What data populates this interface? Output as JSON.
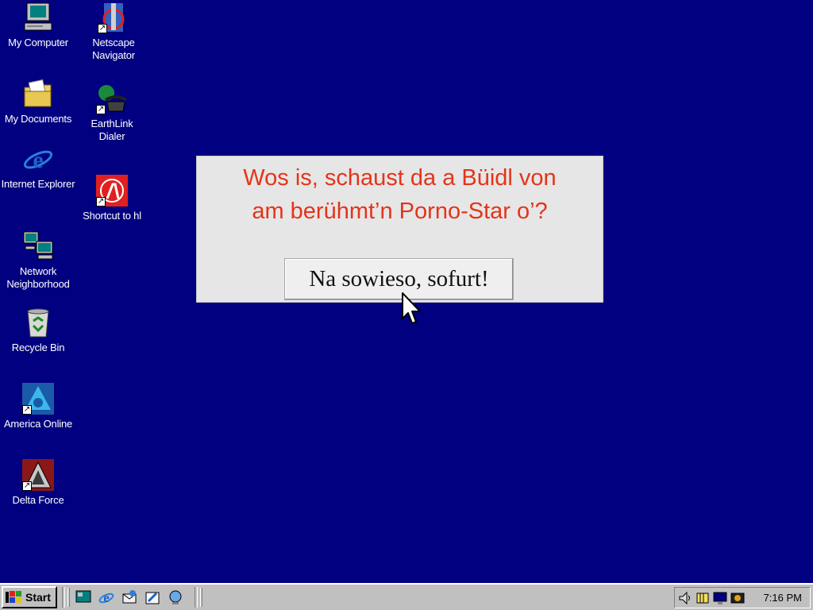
{
  "desktop": {
    "background": "#000080",
    "icons": [
      {
        "label": "My Computer",
        "icon": "computer-icon"
      },
      {
        "label": "My Documents",
        "icon": "folder-documents-icon"
      },
      {
        "label": "Internet Explorer",
        "icon": "internet-explorer-icon"
      },
      {
        "label": "Network Neighborhood",
        "icon": "network-neighborhood-icon"
      },
      {
        "label": "Recycle Bin",
        "icon": "recycle-bin-icon"
      },
      {
        "label": "America Online",
        "icon": "america-online-icon"
      },
      {
        "label": "Delta Force",
        "icon": "delta-force-icon"
      },
      {
        "label": "Netscape Navigator",
        "icon": "netscape-navigator-icon"
      },
      {
        "label": "EarthLink Dialer",
        "icon": "earthlink-dialer-icon"
      },
      {
        "label": "Shortcut to hl",
        "icon": "half-life-icon"
      }
    ]
  },
  "dialog": {
    "message_line1": "Wos is, schaust da a Büidl von",
    "message_line2": "am berühmt’n Porno-Star o’?",
    "button_label": "Na sowieso, sofurt!",
    "message_color": "#e4341a"
  },
  "taskbar": {
    "start_label": "Start",
    "quick_launch": [
      "desktop-icon",
      "internet-explorer-icon",
      "outlook-express-icon",
      "channels-icon",
      "web-publish-icon"
    ],
    "tray_icons": [
      "speaker-icon",
      "battery-icon",
      "monitor-icon",
      "scheduler-icon"
    ],
    "clock": "7:16 PM"
  }
}
